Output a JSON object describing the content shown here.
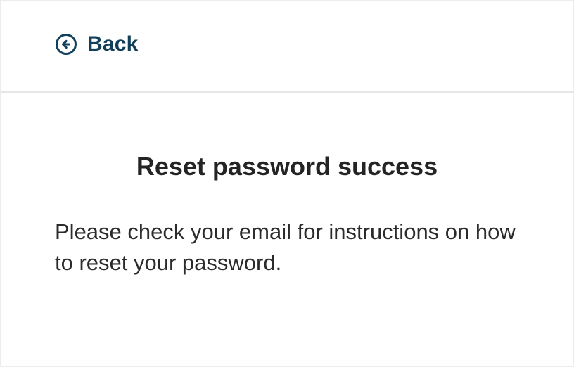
{
  "header": {
    "back_label": "Back",
    "back_icon": "arrow-left-circle-icon"
  },
  "main": {
    "title": "Reset password success",
    "message": "Please check your email for instructions on how to reset your password."
  },
  "colors": {
    "accent": "#123f5a",
    "text": "#222222",
    "border": "#e6e6e6",
    "background": "#ffffff"
  }
}
